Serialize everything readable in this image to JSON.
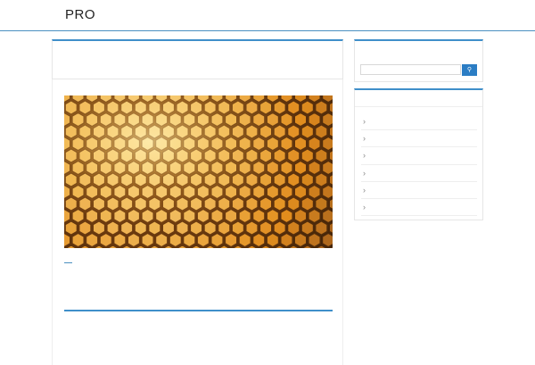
{
  "header": {
    "site_title": "PRO"
  },
  "search": {
    "placeholder": "",
    "button_icon": "search-icon"
  },
  "sidebar": {
    "items": [
      {
        "label": "",
        "icon": "chevron-right-icon"
      },
      {
        "label": "",
        "icon": "chevron-right-icon"
      },
      {
        "label": "",
        "icon": "chevron-right-icon"
      },
      {
        "label": "",
        "icon": "chevron-right-icon"
      },
      {
        "label": "",
        "icon": "chevron-right-icon"
      },
      {
        "label": "",
        "icon": "chevron-right-icon"
      }
    ]
  },
  "colors": {
    "accent": "#3f8fca",
    "button": "#2b7dc4",
    "honey_dark": "#5a3208",
    "honey_light": "#ffdc8a"
  }
}
